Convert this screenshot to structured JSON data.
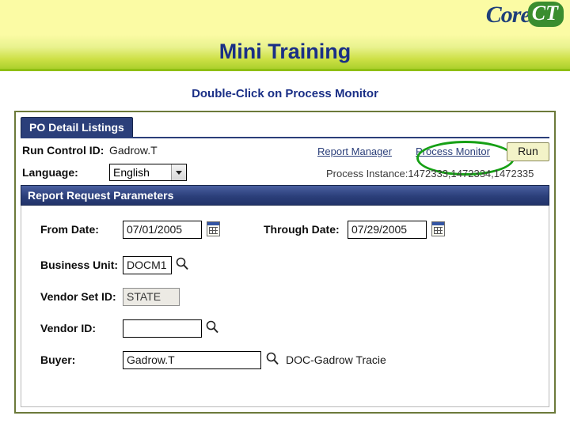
{
  "banner": {
    "logo_core": "Core",
    "logo_ct": "CT",
    "title": "Mini Training",
    "subtitle": "Double-Click on Process Monitor"
  },
  "page": {
    "tab_label": "PO Detail Listings",
    "run_control_label": "Run Control ID:",
    "run_control_value": "Gadrow.T",
    "language_label": "Language:",
    "language_value": "English",
    "report_manager_link": "Report Manager",
    "process_monitor_link": "Process Monitor",
    "run_button": "Run",
    "process_instance_text": "Process Instance:1472333,1472334,1472335",
    "section_header": "Report Request Parameters",
    "fields": {
      "from_date_label": "From Date:",
      "from_date_value": "07/01/2005",
      "through_date_label": "Through Date:",
      "through_date_value": "07/29/2005",
      "business_unit_label": "Business Unit:",
      "business_unit_value": "DOCM1",
      "vendor_set_label": "Vendor Set ID:",
      "vendor_set_value": "STATE",
      "vendor_id_label": "Vendor ID:",
      "vendor_id_value": "",
      "buyer_label": "Buyer:",
      "buyer_value": "Gadrow.T",
      "buyer_description": "DOC-Gadrow Tracie"
    },
    "icons": {
      "from_date_calendar": "calendar-icon",
      "through_date_calendar": "calendar-icon",
      "business_unit_lookup": "magnifier-icon",
      "vendor_id_lookup": "magnifier-icon",
      "buyer_lookup": "magnifier-icon"
    },
    "highlight": {
      "shape": "ellipse",
      "color": "#16a015",
      "target": "process-monitor-link"
    }
  }
}
